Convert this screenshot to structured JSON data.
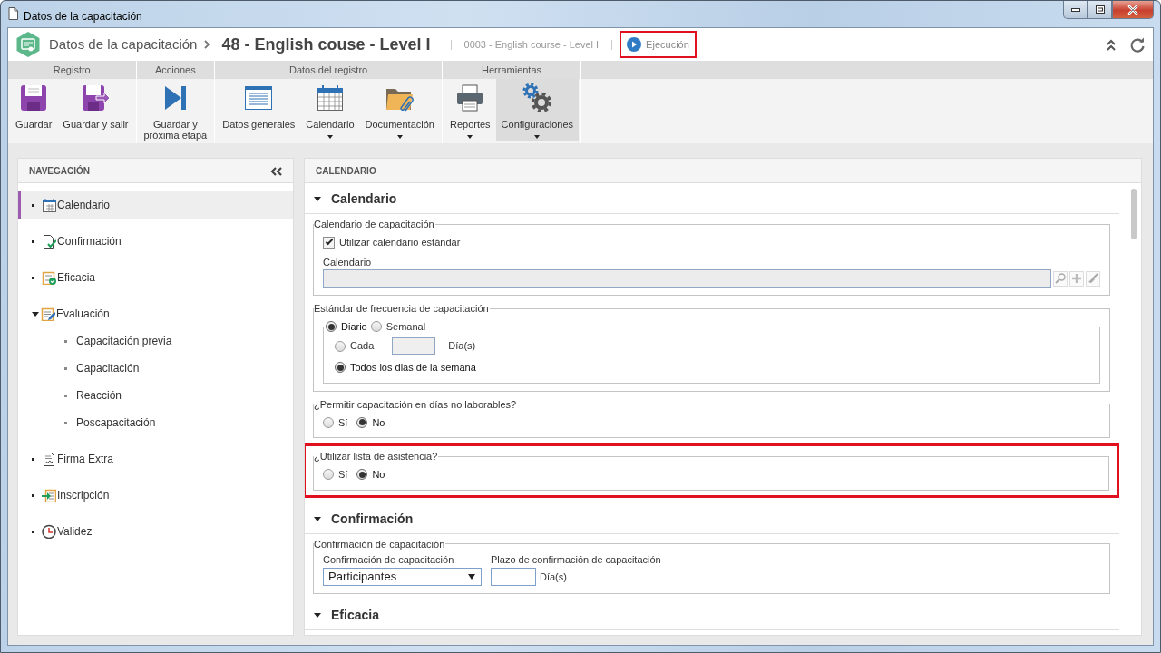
{
  "window": {
    "title": "Datos de la capacitación"
  },
  "header": {
    "module": "Datos de la capacitación",
    "record_title": "48 - English couse - Level I",
    "code": "0003 - English course - Level I",
    "status": {
      "label": "Ejecución",
      "highlighted": true
    }
  },
  "ribbon": [
    {
      "label": "Registro",
      "buttons": [
        {
          "label": "Guardar",
          "dropdown": false,
          "selected": false
        },
        {
          "label": "Guardar y salir",
          "dropdown": false,
          "selected": false
        }
      ]
    },
    {
      "label": "Acciones",
      "buttons": [
        {
          "label": "Guardar y\npróxima etapa",
          "dropdown": false,
          "selected": false
        }
      ]
    },
    {
      "label": "Datos del registro",
      "buttons": [
        {
          "label": "Datos generales",
          "dropdown": false,
          "selected": false
        },
        {
          "label": "Calendario",
          "dropdown": true,
          "selected": false
        },
        {
          "label": "Documentación",
          "dropdown": true,
          "selected": false
        }
      ]
    },
    {
      "label": "Herramientas",
      "buttons": [
        {
          "label": "Reportes",
          "dropdown": true,
          "selected": false
        },
        {
          "label": "Configuraciones",
          "dropdown": true,
          "selected": true
        }
      ]
    }
  ],
  "navigation": {
    "title": "NAVEGACIÓN",
    "items": [
      {
        "label": "Calendario",
        "selected": true
      },
      {
        "label": "Confirmación",
        "selected": false
      },
      {
        "label": "Eficacia",
        "selected": false
      },
      {
        "label": "Evaluación",
        "selected": false,
        "expanded": true,
        "children": [
          {
            "label": "Capacitación previa"
          },
          {
            "label": "Capacitación"
          },
          {
            "label": "Reacción"
          },
          {
            "label": "Poscapacitación"
          }
        ]
      },
      {
        "label": "Firma Extra",
        "selected": false
      },
      {
        "label": "Inscripción",
        "selected": false
      },
      {
        "label": "Validez",
        "selected": false
      }
    ]
  },
  "panel": {
    "title": "CALENDARIO",
    "sections": [
      {
        "title": "Calendario",
        "expanded": true,
        "fieldsets": [
          {
            "legend": "Calendario de capacitación",
            "highlighted": false,
            "rows": [
              {
                "kind": "checkbox",
                "label": "Utilizar calendario estándar",
                "checked": true
              },
              {
                "kind": "lookup",
                "label": "Calendario",
                "disabled": true
              }
            ]
          },
          {
            "legend": "Estándar de frecuencia de capacitación",
            "highlighted": false,
            "rows": [
              {
                "kind": "radio-frame",
                "options": [
                  {
                    "label": "Diario",
                    "selected": true
                  },
                  {
                    "label": "Semanal",
                    "selected": false
                  }
                ],
                "rows": [
                  {
                    "kind": "radio-input",
                    "label": "Cada",
                    "selected": false,
                    "suffix": "Día(s)"
                  },
                  {
                    "kind": "radio",
                    "label": "Todos los dias de la semana",
                    "selected": true
                  }
                ]
              }
            ]
          },
          {
            "legend": "¿Permitir capacitación en días no laborables?",
            "highlighted": false,
            "rows": [
              {
                "kind": "radios",
                "options": [
                  {
                    "label": "Sí",
                    "selected": false
                  },
                  {
                    "label": "No",
                    "selected": true
                  }
                ]
              }
            ]
          },
          {
            "legend": "¿Utilizar lista de asistencia?",
            "highlighted": true,
            "rows": [
              {
                "kind": "radios",
                "options": [
                  {
                    "label": "Sí",
                    "selected": false
                  },
                  {
                    "label": "No",
                    "selected": true
                  }
                ]
              }
            ]
          }
        ]
      },
      {
        "title": "Confirmación",
        "expanded": true,
        "fieldsets": [
          {
            "legend": "Confirmación de capacitación",
            "highlighted": false,
            "rows": [
              {
                "kind": "fields",
                "fields": [
                  {
                    "kind": "select",
                    "label": "Confirmación de capacitación",
                    "value": "Participantes"
                  },
                  {
                    "kind": "number",
                    "label": "Plazo de confirmación de capacitación",
                    "suffix": "Día(s)"
                  }
                ]
              }
            ]
          }
        ]
      },
      {
        "title": "Eficacia",
        "expanded": true
      }
    ]
  }
}
